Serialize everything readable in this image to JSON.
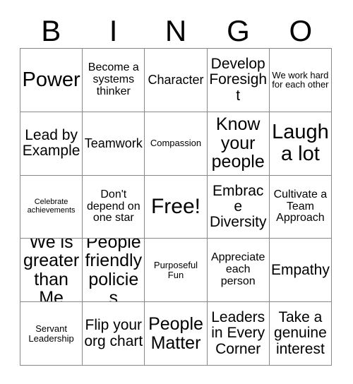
{
  "card": {
    "title": "BINGO",
    "header_letters": [
      "B",
      "I",
      "N",
      "G",
      "O"
    ],
    "free_space": "Free!",
    "colors": {
      "text": "#000000",
      "grid_line": "#888888",
      "background": "#ffffff"
    },
    "rows": [
      [
        {
          "text": "Power",
          "size": "fs-xxl"
        },
        {
          "text": "Become a systems thinker",
          "size": "fs-s"
        },
        {
          "text": "Character",
          "size": "fs-m"
        },
        {
          "text": "Develop Foresight",
          "size": "fs-l"
        },
        {
          "text": "We work hard for each other",
          "size": "fs-xs"
        }
      ],
      [
        {
          "text": "Lead by Example",
          "size": "fs-l"
        },
        {
          "text": "Teamwork",
          "size": "fs-m"
        },
        {
          "text": "Compassion",
          "size": "fs-xs"
        },
        {
          "text": "Know your people",
          "size": "fs-xl"
        },
        {
          "text": "Laugh a lot",
          "size": "fs-xxl"
        }
      ],
      [
        {
          "text": "Celebrate achievements",
          "size": "fs-xxs"
        },
        {
          "text": "Don't depend on one star",
          "size": "fs-s"
        },
        {
          "text": "Free!",
          "size": "free"
        },
        {
          "text": "Embrace Diversity",
          "size": "fs-l"
        },
        {
          "text": "Cultivate a Team Approach",
          "size": "fs-s"
        }
      ],
      [
        {
          "text": "We is greater than Me",
          "size": "fs-xl"
        },
        {
          "text": "People friendly policies",
          "size": "fs-xl"
        },
        {
          "text": "Purposeful Fun",
          "size": "fs-xs"
        },
        {
          "text": "Appreciate each person",
          "size": "fs-s"
        },
        {
          "text": "Empathy",
          "size": "fs-l"
        }
      ],
      [
        {
          "text": "Servant Leadership",
          "size": "fs-xs"
        },
        {
          "text": "Flip your org chart",
          "size": "fs-l"
        },
        {
          "text": "People Matter",
          "size": "fs-xl"
        },
        {
          "text": "Leaders in Every Corner",
          "size": "fs-l"
        },
        {
          "text": "Take a genuine interest",
          "size": "fs-l"
        }
      ]
    ]
  }
}
